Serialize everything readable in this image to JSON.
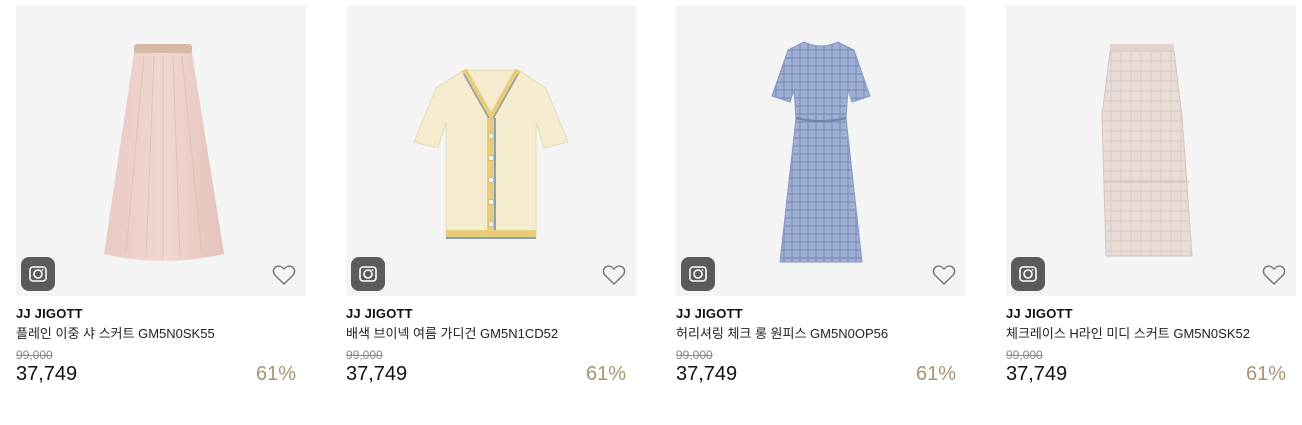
{
  "products": [
    {
      "brand": "JJ JIGOTT",
      "name": "플레인 이중 샤 스커트 GM5N0SK55",
      "original_price": "99,000",
      "sale_price": "37,749",
      "discount": "61%",
      "image": "pink-pleated-tulle-skirt"
    },
    {
      "brand": "JJ JIGOTT",
      "name": "배색 브이넥 여름 가디건 GM5N1CD52",
      "original_price": "99,000",
      "sale_price": "37,749",
      "discount": "61%",
      "image": "cream-vneck-cardigan"
    },
    {
      "brand": "JJ JIGOTT",
      "name": "허리셔링 체크 롱 원피스 GM5N0OP56",
      "original_price": "99,000",
      "sale_price": "37,749",
      "discount": "61%",
      "image": "blue-check-long-dress"
    },
    {
      "brand": "JJ JIGOTT",
      "name": "체크레이스 H라인 미디 스커트 GM5N0SK52",
      "original_price": "99,000",
      "sale_price": "37,749",
      "discount": "61%",
      "image": "beige-lace-hline-skirt"
    }
  ],
  "icons": {
    "camera": "camera-icon",
    "wishlist": "heart-outline-icon"
  },
  "colors": {
    "discount": "#a99470",
    "thumb_bg": "#f4f4f4",
    "camera_button_bg": "#5b5b5b"
  }
}
